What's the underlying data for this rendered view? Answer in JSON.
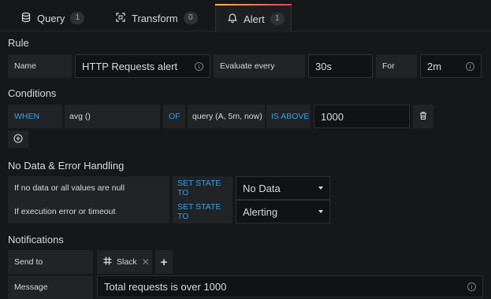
{
  "tabs": [
    {
      "label": "Query",
      "count": "1",
      "icon": "database-icon"
    },
    {
      "label": "Transform",
      "count": "0",
      "icon": "transform-icon"
    },
    {
      "label": "Alert",
      "count": "1",
      "icon": "bell-icon",
      "active": true
    }
  ],
  "rule": {
    "heading": "Rule",
    "name_label": "Name",
    "name_value": "HTTP Requests alert",
    "evaluate_label": "Evaluate every",
    "evaluate_value": "30s",
    "for_label": "For",
    "for_value": "2m"
  },
  "conditions": {
    "heading": "Conditions",
    "when": "WHEN",
    "func": "avg ()",
    "of": "OF",
    "query": "query (A, 5m, now)",
    "comparator": "IS ABOVE",
    "threshold": "1000"
  },
  "nodata": {
    "heading": "No Data & Error Handling",
    "rows": [
      {
        "label": "If no data or all values are null",
        "action": "SET STATE TO",
        "value": "No Data"
      },
      {
        "label": "If execution error or timeout",
        "action": "SET STATE TO",
        "value": "Alerting"
      }
    ]
  },
  "notifications": {
    "heading": "Notifications",
    "send_to_label": "Send to",
    "channel": "Slack",
    "message_label": "Message",
    "message_value": "Total requests is over 1000"
  },
  "colors": {
    "accent_blue": "#33a2e5",
    "bg": "#161719"
  }
}
